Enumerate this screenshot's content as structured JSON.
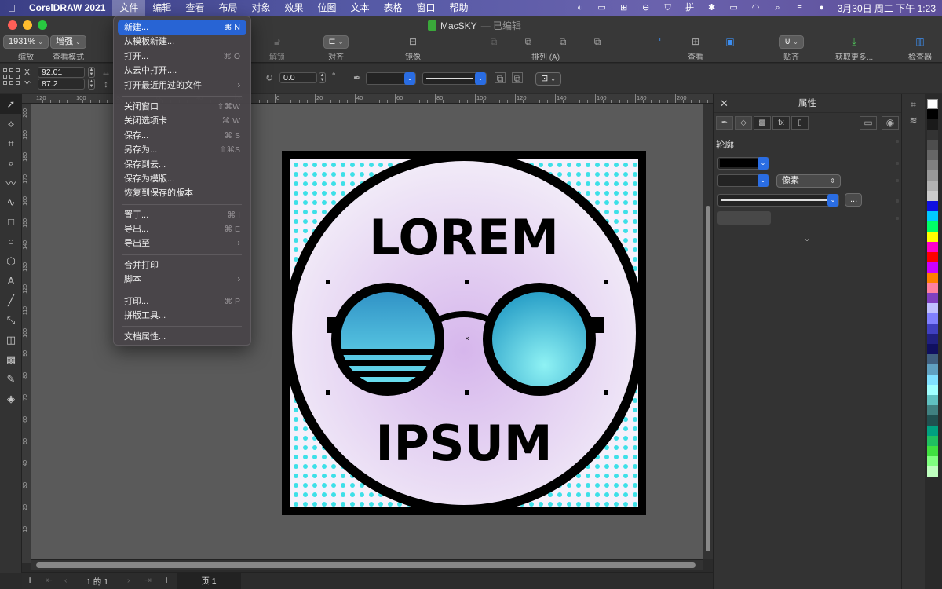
{
  "menubar": {
    "app_name": "CorelDRAW 2021",
    "items": [
      "文件",
      "编辑",
      "查看",
      "布局",
      "对象",
      "效果",
      "位图",
      "文本",
      "表格",
      "窗口",
      "帮助"
    ],
    "active": "文件",
    "clock": "3月30日 周二 下午 1:23"
  },
  "window": {
    "doc_title": "MacSKY",
    "status": "— 已编辑"
  },
  "toolbar": {
    "zoom_value": "1931%",
    "zoom_label": "缩放",
    "view_mode_value": "增强",
    "view_mode_label": "查看模式",
    "unlock_label": "解锁",
    "align_label": "对齐",
    "mirror_label": "镜像",
    "arrange_label": "排列 (A)",
    "view_label": "查看",
    "snap_label": "贴齐",
    "get_more_label": "获取更多...",
    "inspector_label": "检查器"
  },
  "propbar": {
    "x_label": "X:",
    "x_value": "92.01",
    "y_label": "Y:",
    "y_value": "87.2",
    "rotation_value": "0.0",
    "degree": "°"
  },
  "ruler": {
    "h_ticks": [
      "120",
      "100",
      "80",
      "60",
      "40",
      "20",
      "0",
      "20",
      "40",
      "60",
      "80",
      "100",
      "120",
      "140",
      "160",
      "180",
      "200"
    ],
    "v_ticks": [
      "200",
      "190",
      "180",
      "170",
      "160",
      "150",
      "140",
      "130",
      "120",
      "110",
      "100",
      "90",
      "80",
      "70",
      "60",
      "50",
      "40",
      "30",
      "20",
      "10"
    ]
  },
  "artwork": {
    "top_text": "LOREM",
    "bottom_text": "IPSUM"
  },
  "pagebar": {
    "page_count": "1 的 1",
    "tab": "页 1"
  },
  "panel": {
    "title": "属性",
    "section": "轮廓",
    "unit_value": "像素",
    "more_button": "..."
  },
  "file_menu": {
    "groups": [
      [
        {
          "label": "新建...",
          "shortcut": "⌘ N",
          "highlighted": true
        },
        {
          "label": "从模板新建...",
          "shortcut": ""
        },
        {
          "label": "打开...",
          "shortcut": "⌘ O"
        },
        {
          "label": "从云中打开....",
          "shortcut": ""
        },
        {
          "label": "打开最近用过的文件",
          "shortcut": "",
          "submenu": true
        }
      ],
      [
        {
          "label": "关闭窗口",
          "shortcut": "⇧⌘W"
        },
        {
          "label": "关闭选项卡",
          "shortcut": "⌘ W"
        },
        {
          "label": "保存...",
          "shortcut": "⌘ S"
        },
        {
          "label": "另存为...",
          "shortcut": "⇧⌘S"
        },
        {
          "label": "保存到云...",
          "shortcut": ""
        },
        {
          "label": "保存为模版...",
          "shortcut": ""
        },
        {
          "label": "恢复到保存的版本",
          "shortcut": ""
        }
      ],
      [
        {
          "label": "置于...",
          "shortcut": "⌘ I"
        },
        {
          "label": "导出...",
          "shortcut": "⌘ E"
        },
        {
          "label": "导出至",
          "shortcut": "",
          "submenu": true
        }
      ],
      [
        {
          "label": "合并打印",
          "shortcut": ""
        },
        {
          "label": "脚本",
          "shortcut": "",
          "submenu": true
        }
      ],
      [
        {
          "label": "打印...",
          "shortcut": "⌘ P"
        },
        {
          "label": "拼版工具...",
          "shortcut": ""
        }
      ],
      [
        {
          "label": "文档属性...",
          "shortcut": ""
        }
      ]
    ]
  },
  "palette": [
    "#ffffff",
    "#000000",
    "#1a1a1a",
    "#333333",
    "#4d4d4d",
    "#666666",
    "#808080",
    "#999999",
    "#b3b3b3",
    "#cccccc",
    "#1010e0",
    "#00c8ff",
    "#00ff66",
    "#ffff00",
    "#ff00cc",
    "#ff0000",
    "#cc00ff",
    "#ff8000",
    "#ff80a0",
    "#8040c0",
    "#c0c0ff",
    "#8080ff",
    "#4040c0",
    "#202080",
    "#101060",
    "#406080",
    "#60a0c0",
    "#80e0ff",
    "#a0ffff",
    "#60c0c0",
    "#408080",
    "#205050",
    "#00a080",
    "#20c060",
    "#40e040",
    "#80ff80",
    "#c0ffc0"
  ]
}
